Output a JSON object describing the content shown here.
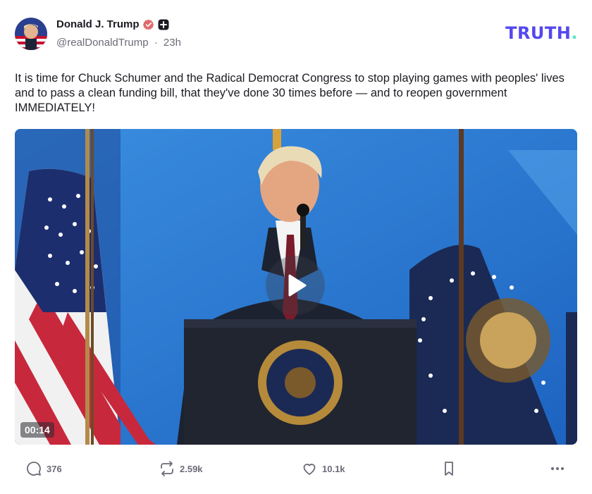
{
  "author": {
    "display_name": "Donald J. Trump",
    "handle": "@realDonaldTrump",
    "separator": "·",
    "time_ago": "23h",
    "verified_icon": "verified-badge-icon",
    "plus_icon": "plus-badge-icon"
  },
  "brand": {
    "logo_text": "TRUTH",
    "logo_dot": ".",
    "logo_color": "#5448ee",
    "dot_color": "#5ce8c8"
  },
  "post": {
    "text": "It is time for Chuck Schumer and the Radical Democrat Congress to stop playing games with peoples' lives and to pass a clean funding bill, that they've done 30 times before — and to reopen government IMMEDIATELY!"
  },
  "media": {
    "type": "video",
    "duration": "00:14",
    "play_icon": "play-icon"
  },
  "actions": {
    "replies": "376",
    "retruths": "2.59k",
    "likes": "10.1k",
    "reply_icon": "comment-icon",
    "retruth_icon": "repost-icon",
    "like_icon": "heart-icon",
    "bookmark_icon": "bookmark-icon",
    "more_icon": "more-icon"
  }
}
